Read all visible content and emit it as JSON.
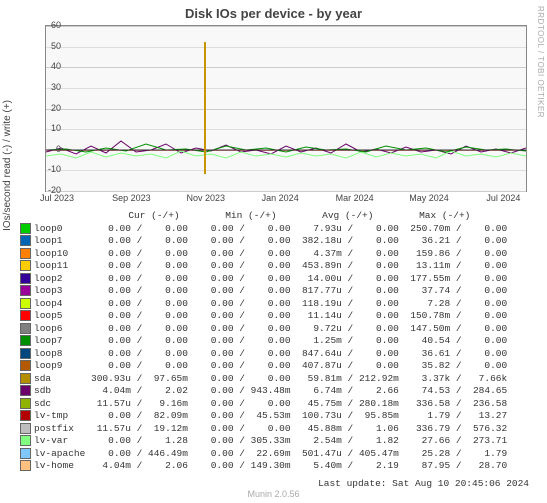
{
  "title": "Disk IOs per device - by year",
  "ylabel": "IOs/second read (-) / write (+)",
  "watermark": "RRDTOOL / TOBI OETIKER",
  "footer": "Munin 2.0.56",
  "last_update": "Last update: Sat Aug 10 20:45:06 2024",
  "chart_data": {
    "type": "line",
    "ylim": [
      -20,
      60
    ],
    "yticks": [
      -20,
      -10,
      0,
      10,
      20,
      30,
      40,
      50,
      60
    ],
    "xticks": [
      "Jul 2023",
      "Sep 2023",
      "Nov 2023",
      "Jan 2024",
      "Mar 2024",
      "May 2024",
      "Jul 2024"
    ],
    "description": "Time series of disk IOs per second, mostly near 0 with small noise (±5) across the year, one large spike to ~52 around Nov 2023.",
    "spike": {
      "x_label": "Nov 2023",
      "value": 52
    }
  },
  "legend": {
    "header_cols": [
      "Cur (-/+)",
      "Min (-/+)",
      "Avg (-/+)",
      "Max (-/+)"
    ],
    "rows": [
      {
        "color": "#00cc00",
        "name": "loop0",
        "cur_r": "0.00",
        "cur_w": "0.00",
        "min_r": "0.00",
        "min_w": "0.00",
        "avg_r": "7.93u",
        "avg_w": "0.00",
        "max_r": "250.70m",
        "max_w": "0.00"
      },
      {
        "color": "#0066b3",
        "name": "loop1",
        "cur_r": "0.00",
        "cur_w": "0.00",
        "min_r": "0.00",
        "min_w": "0.00",
        "avg_r": "382.18u",
        "avg_w": "0.00",
        "max_r": "36.21",
        "max_w": "0.00"
      },
      {
        "color": "#ff8000",
        "name": "loop10",
        "cur_r": "0.00",
        "cur_w": "0.00",
        "min_r": "0.00",
        "min_w": "0.00",
        "avg_r": "4.37m",
        "avg_w": "0.00",
        "max_r": "159.86",
        "max_w": "0.00"
      },
      {
        "color": "#ffcc00",
        "name": "loop11",
        "cur_r": "0.00",
        "cur_w": "0.00",
        "min_r": "0.00",
        "min_w": "0.00",
        "avg_r": "453.89n",
        "avg_w": "0.00",
        "max_r": "13.11m",
        "max_w": "0.00"
      },
      {
        "color": "#330099",
        "name": "loop2",
        "cur_r": "0.00",
        "cur_w": "0.00",
        "min_r": "0.00",
        "min_w": "0.00",
        "avg_r": "14.00u",
        "avg_w": "0.00",
        "max_r": "177.55m",
        "max_w": "0.00"
      },
      {
        "color": "#990099",
        "name": "loop3",
        "cur_r": "0.00",
        "cur_w": "0.00",
        "min_r": "0.00",
        "min_w": "0.00",
        "avg_r": "817.77u",
        "avg_w": "0.00",
        "max_r": "37.74",
        "max_w": "0.00"
      },
      {
        "color": "#ccff00",
        "name": "loop4",
        "cur_r": "0.00",
        "cur_w": "0.00",
        "min_r": "0.00",
        "min_w": "0.00",
        "avg_r": "118.19u",
        "avg_w": "0.00",
        "max_r": "7.28",
        "max_w": "0.00"
      },
      {
        "color": "#ff0000",
        "name": "loop5",
        "cur_r": "0.00",
        "cur_w": "0.00",
        "min_r": "0.00",
        "min_w": "0.00",
        "avg_r": "11.14u",
        "avg_w": "0.00",
        "max_r": "150.78m",
        "max_w": "0.00"
      },
      {
        "color": "#808080",
        "name": "loop6",
        "cur_r": "0.00",
        "cur_w": "0.00",
        "min_r": "0.00",
        "min_w": "0.00",
        "avg_r": "9.72u",
        "avg_w": "0.00",
        "max_r": "147.50m",
        "max_w": "0.00"
      },
      {
        "color": "#008f00",
        "name": "loop7",
        "cur_r": "0.00",
        "cur_w": "0.00",
        "min_r": "0.00",
        "min_w": "0.00",
        "avg_r": "1.25m",
        "avg_w": "0.00",
        "max_r": "40.54",
        "max_w": "0.00"
      },
      {
        "color": "#00487d",
        "name": "loop8",
        "cur_r": "0.00",
        "cur_w": "0.00",
        "min_r": "0.00",
        "min_w": "0.00",
        "avg_r": "847.64u",
        "avg_w": "0.00",
        "max_r": "36.61",
        "max_w": "0.00"
      },
      {
        "color": "#b35a00",
        "name": "loop9",
        "cur_r": "0.00",
        "cur_w": "0.00",
        "min_r": "0.00",
        "min_w": "0.00",
        "avg_r": "407.87u",
        "avg_w": "0.00",
        "max_r": "35.82",
        "max_w": "0.00"
      },
      {
        "color": "#b38f00",
        "name": "sda",
        "cur_r": "300.93u",
        "cur_w": "97.65m",
        "min_r": "0.00",
        "min_w": "0.00",
        "avg_r": "59.81m",
        "avg_w": "212.92m",
        "max_r": "3.37k",
        "max_w": "7.66k"
      },
      {
        "color": "#6b006b",
        "name": "sdb",
        "cur_r": "4.04m",
        "cur_w": "2.02",
        "min_r": "0.00",
        "min_w": "943.48m",
        "avg_r": "6.74m",
        "avg_w": "2.66",
        "max_r": "74.53",
        "max_w": "284.65"
      },
      {
        "color": "#8fb300",
        "name": "sdc",
        "cur_r": "11.57u",
        "cur_w": "9.16m",
        "min_r": "0.00",
        "min_w": "0.00",
        "avg_r": "45.75m",
        "avg_w": "280.18m",
        "max_r": "336.58",
        "max_w": "236.58"
      },
      {
        "color": "#b30000",
        "name": "lv-tmp",
        "cur_r": "0.00",
        "cur_w": "82.09m",
        "min_r": "0.00",
        "min_w": "45.53m",
        "avg_r": "100.73u",
        "avg_w": "95.85m",
        "max_r": "1.79",
        "max_w": "13.27"
      },
      {
        "color": "#bebebe",
        "name": "postfix",
        "cur_r": "11.57u",
        "cur_w": "19.12m",
        "min_r": "0.00",
        "min_w": "0.00",
        "avg_r": "45.88m",
        "avg_w": "1.06",
        "max_r": "336.79",
        "max_w": "576.32"
      },
      {
        "color": "#80ff80",
        "name": "lv-var",
        "cur_r": "0.00",
        "cur_w": "1.28",
        "min_r": "0.00",
        "min_w": "305.33m",
        "avg_r": "2.54m",
        "avg_w": "1.82",
        "max_r": "27.66",
        "max_w": "273.71"
      },
      {
        "color": "#80c9ff",
        "name": "lv-apache",
        "cur_r": "0.00",
        "cur_w": "446.49m",
        "min_r": "0.00",
        "min_w": "22.69m",
        "avg_r": "501.47u",
        "avg_w": "405.47m",
        "max_r": "25.28",
        "max_w": "1.79"
      },
      {
        "color": "#ffc080",
        "name": "lv-home",
        "cur_r": "4.04m",
        "cur_w": "2.06",
        "min_r": "0.00",
        "min_w": "149.30m",
        "avg_r": "5.40m",
        "avg_w": "2.19",
        "max_r": "87.95",
        "max_w": "28.70"
      }
    ]
  }
}
